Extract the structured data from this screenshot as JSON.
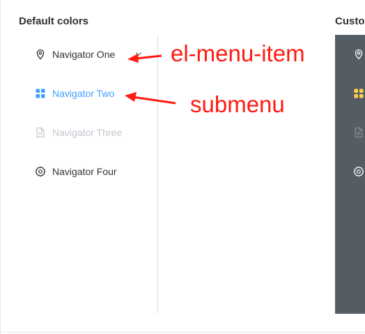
{
  "sections": {
    "default_title": "Default colors",
    "custom_title": "Custo"
  },
  "menu": {
    "items": [
      {
        "label": "Navigator One",
        "icon": "location-icon",
        "state": "normal",
        "has_submenu": true
      },
      {
        "label": "Navigator Two",
        "icon": "menu-grid-icon",
        "state": "active"
      },
      {
        "label": "Navigator Three",
        "icon": "document-icon",
        "state": "disabled"
      },
      {
        "label": "Navigator Four",
        "icon": "gear-icon",
        "state": "normal"
      }
    ]
  },
  "annotations": {
    "menu_item_label": "el-menu-item",
    "submenu_label": "submenu"
  },
  "colors": {
    "active": "#409eff",
    "disabled": "#c0c4cc",
    "text": "#303133",
    "dark_menu_bg": "#545c64",
    "dark_active_icon": "#ffd04b",
    "annotation": "#ff1a10"
  }
}
